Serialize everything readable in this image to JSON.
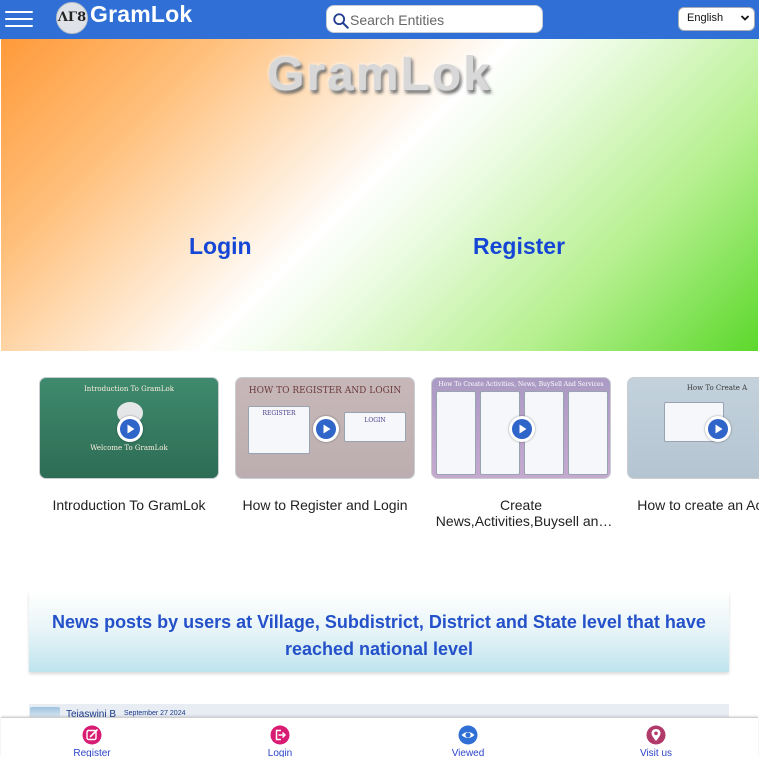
{
  "header": {
    "logo_text": "ΛΓ8",
    "brand": "GramLok",
    "search": {
      "placeholder": "Search Entities",
      "value": ""
    },
    "language": {
      "selected": "English"
    }
  },
  "hero": {
    "title": "GramLok",
    "login_label": "Login",
    "register_label": "Register"
  },
  "videos": [
    {
      "title": "Introduction To GramLok",
      "thumb_top": "Introduction To GramLok",
      "thumb_bottom": "Welcome To GramLok"
    },
    {
      "title": "How to Register and Login",
      "thumb_top": "HOW TO REGISTER AND LOGIN",
      "thumb_left": "REGISTER",
      "thumb_right": "LOGIN"
    },
    {
      "title": "Create News,Activities,Buysell and Services",
      "thumb_top": "How To Create Activities, News, BuySell And Services"
    },
    {
      "title": "How to create an Account",
      "thumb_top": "How To Create A"
    }
  ],
  "news_section": {
    "heading": "News posts by users at Village, Subdistrict, District and State level that have reached national level"
  },
  "post": {
    "author": "Tejaswini B",
    "date": "September 27 2024"
  },
  "bottom_nav": {
    "register": "Register",
    "login": "Login",
    "viewed": "Viewed",
    "visit": "Visit us"
  },
  "colors": {
    "topbar": "#2f6fd6",
    "link": "#1646d6",
    "news_heading": "#2450c9",
    "bottom_nav_label": "#2b45c9"
  },
  "icons": [
    "hamburger-icon",
    "search-icon",
    "chevron-down-icon",
    "play-icon",
    "edit-icon",
    "login-icon",
    "eye-icon",
    "location-pin-icon"
  ]
}
